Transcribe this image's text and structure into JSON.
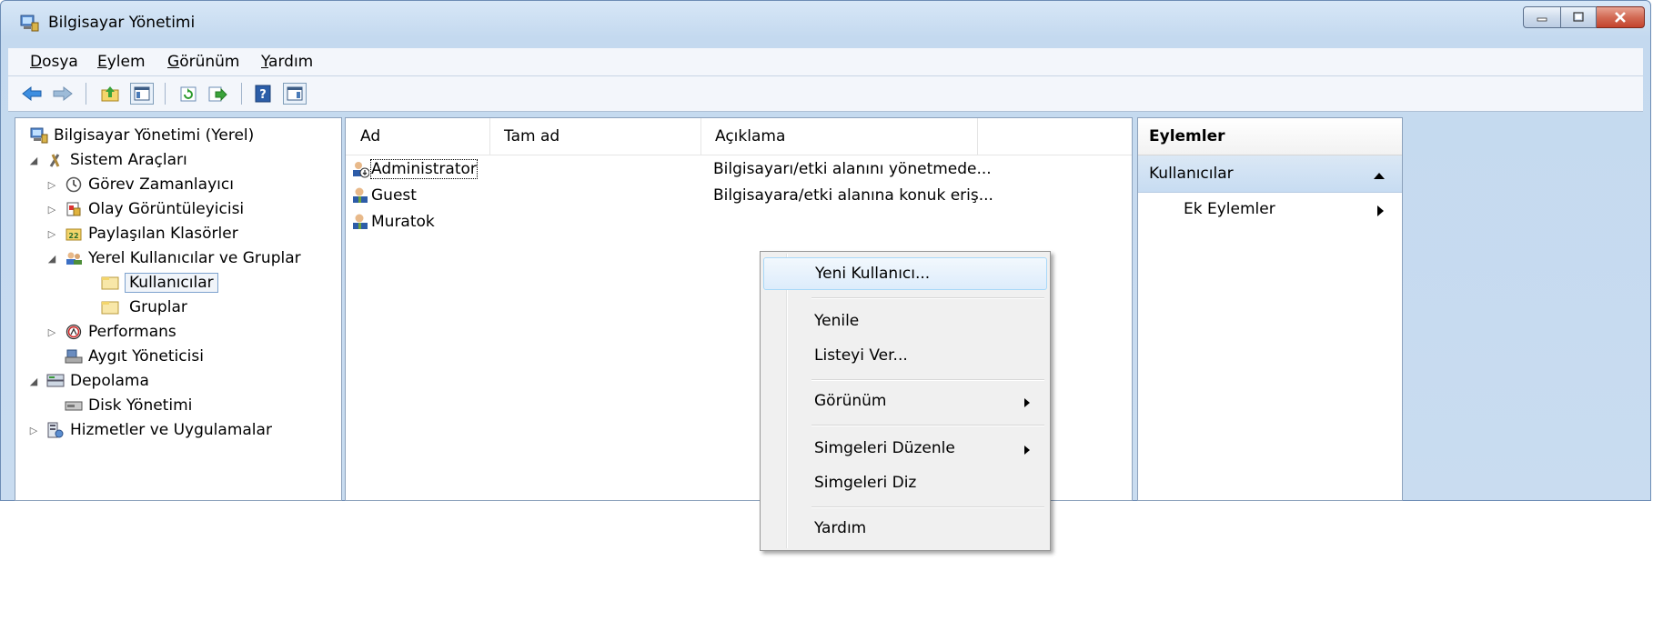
{
  "window": {
    "title": "Bilgisayar Yönetimi"
  },
  "menubar": [
    {
      "label": "Dosya",
      "key": "D",
      "rest": "osya"
    },
    {
      "label": "Eylem",
      "key": "E",
      "rest": "ylem"
    },
    {
      "label": "Görünüm",
      "key": "G",
      "rest": "örünüm"
    },
    {
      "label": "Yardım",
      "key": "Y",
      "rest": "ardım"
    }
  ],
  "toolbar": {
    "icons": [
      "back-arrow-icon",
      "forward-arrow-icon",
      "up-folder-icon",
      "show-hide-console-tree-icon",
      "refresh-icon",
      "export-list-icon",
      "help-icon",
      "show-hide-action-pane-icon"
    ]
  },
  "tree": {
    "root": "Bilgisayar Yönetimi (Yerel)",
    "system_tools": "Sistem Araçları",
    "task_scheduler": "Görev Zamanlayıcı",
    "event_viewer": "Olay Görüntüleyicisi",
    "shared_folders": "Paylaşılan Klasörler",
    "local_users_groups": "Yerel Kullanıcılar ve Gruplar",
    "users": "Kullanıcılar",
    "groups": "Gruplar",
    "performance": "Performans",
    "device_manager": "Aygıt Yöneticisi",
    "storage": "Depolama",
    "disk_management": "Disk Yönetimi",
    "services_apps": "Hizmetler ve Uygulamalar"
  },
  "list": {
    "columns": [
      "Ad",
      "Tam ad",
      "Açıklama"
    ],
    "rows": [
      {
        "name": "Administrator",
        "fullname": "",
        "desc": "Bilgisayarı/etki alanını yönetmede..."
      },
      {
        "name": "Guest",
        "fullname": "",
        "desc": "Bilgisayara/etki alanına konuk eriş..."
      },
      {
        "name": "Muratok",
        "fullname": "",
        "desc": ""
      }
    ]
  },
  "actions": {
    "header": "Eylemler",
    "section": "Kullanıcılar",
    "more": "Ek Eylemler"
  },
  "context_menu": {
    "new_user": "Yeni Kullanıcı...",
    "refresh": "Yenile",
    "export_list": "Listeyi Ver...",
    "view": "Görünüm",
    "arrange_icons": "Simgeleri Düzenle",
    "line_up_icons": "Simgeleri Diz",
    "help": "Yardım"
  }
}
